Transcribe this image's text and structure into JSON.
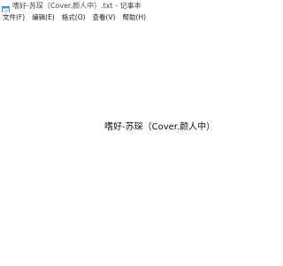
{
  "window": {
    "title": "嗜好-苏琛（Cover.颜人中）.txt - 记事本",
    "icon": "notepad-icon"
  },
  "menu": {
    "items": [
      {
        "label": "文件(F)"
      },
      {
        "label": "编辑(E)"
      },
      {
        "label": "格式(O)"
      },
      {
        "label": "查看(V)"
      },
      {
        "label": "帮助(H)"
      }
    ]
  },
  "editor": {
    "content": "嗜好-苏琛（Cover.颜人中）"
  },
  "colors": {
    "background": "#ffffff",
    "text": "#111111",
    "icon_accent": "#4a90d9"
  }
}
